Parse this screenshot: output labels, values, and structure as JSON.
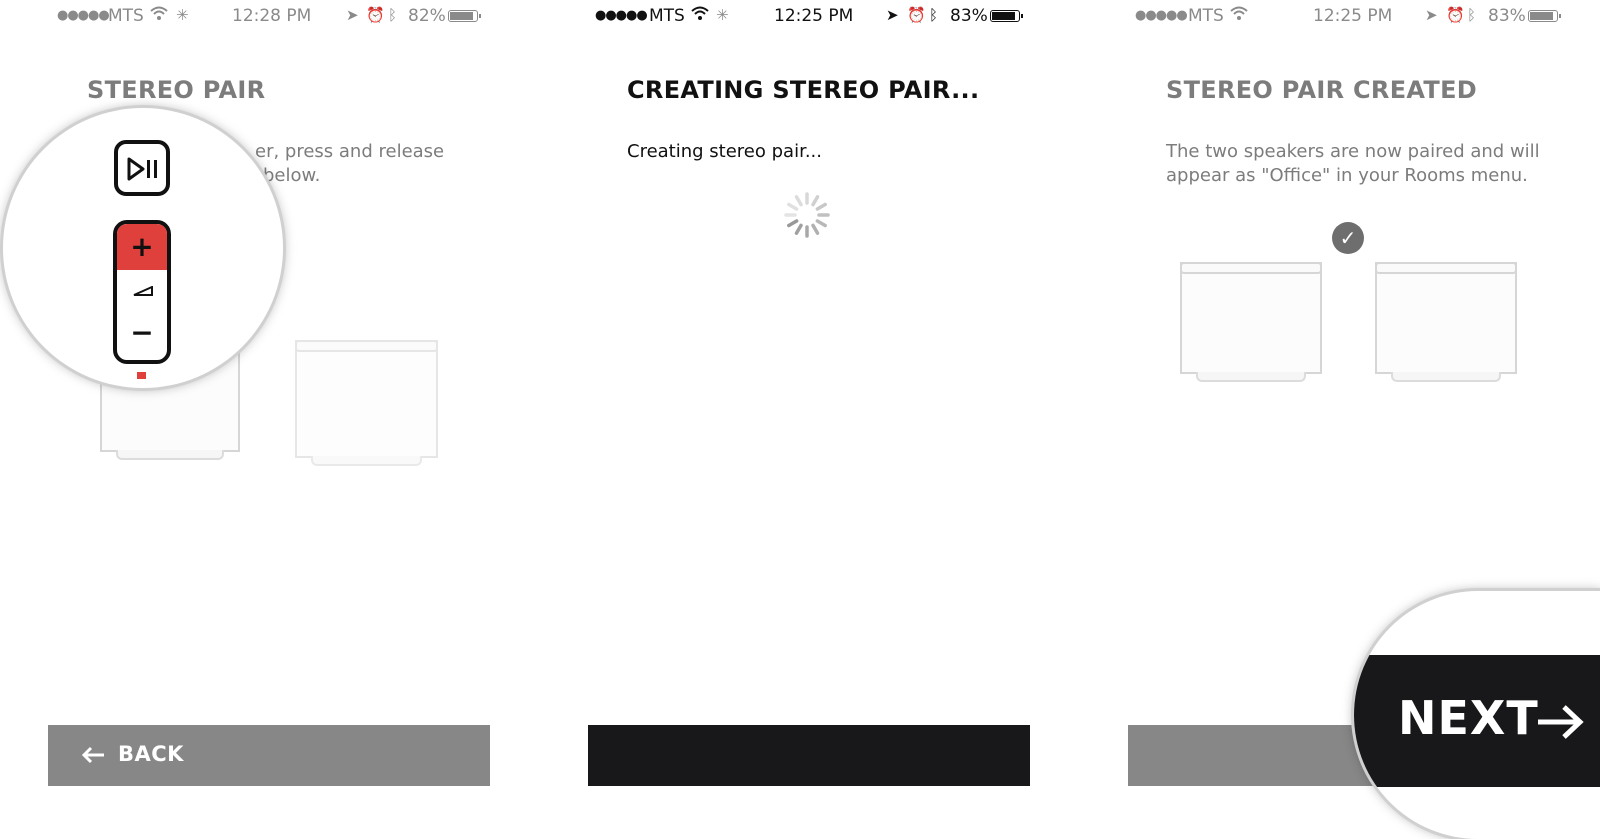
{
  "panels": [
    {
      "status": {
        "carrier": "MTS",
        "time": "12:28 PM",
        "battery": "82%",
        "battery_level": 0.82
      },
      "heading": "STEREO PAIR",
      "body_lines": [
        "er, press and release",
        "below."
      ],
      "magnifier": {
        "play_pause_icon": "play-pause-icon",
        "plus": "+",
        "minus": "−"
      },
      "back_label": "BACK"
    },
    {
      "status": {
        "carrier": "MTS",
        "time": "12:25 PM",
        "battery": "83%",
        "battery_level": 0.83
      },
      "heading": "CREATING STEREO PAIR...",
      "body_lines": [
        "Creating stereo pair..."
      ]
    },
    {
      "status": {
        "carrier": "MTS",
        "time": "12:25 PM",
        "battery": "83%",
        "battery_level": 0.83
      },
      "heading": "STEREO PAIR CREATED",
      "body_lines": [
        "The two speakers are now paired and will",
        "appear as \"Office\" in your Rooms menu."
      ],
      "next_label": "NEXT"
    }
  ],
  "colors": {
    "accent_red": "#e0403c",
    "bar_gray": "#878787",
    "bar_dark": "#18181a"
  }
}
